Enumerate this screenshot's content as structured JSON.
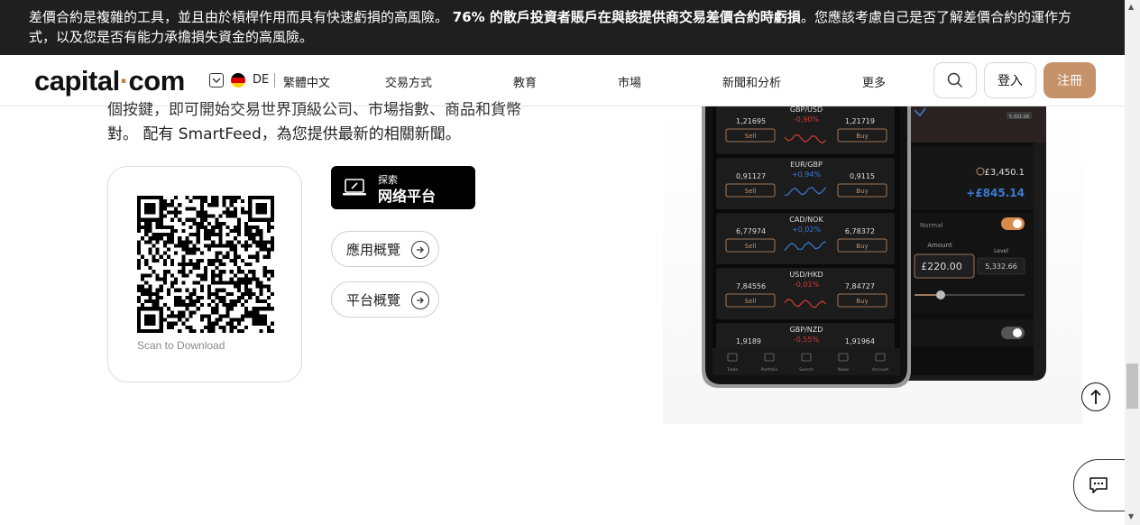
{
  "risk_banner": {
    "part1": "差價合約是複雜的工具，並且由於槓桿作用而具有快速虧損的高風險。",
    "bold": "76% 的散戶投資者賬戶在與該提供商交易差價合約時虧損",
    "part2": "。您應該考慮自己是否了解差價合約的運作方式，以及您是否有能力承擔損失資金的高風險。"
  },
  "header": {
    "logo_left": "capital",
    "logo_dot": "·",
    "logo_right": "com",
    "lang_code": "DE",
    "lang_name": "繁體中文",
    "nav": [
      "交易方式",
      "教育",
      "市場",
      "新聞和分析",
      "更多"
    ],
    "login": "登入",
    "signup": "注冊"
  },
  "main": {
    "desc_clipped": "個按鍵，即可開始交易世界頂級公司、市場指數、商品和貨幣",
    "desc_line2": "對。 配有 SmartFeed，為您提供最新的相關新聞。",
    "qr_caption": "Scan to Download",
    "web_btn_small": "探索",
    "web_btn_big": "网络平台",
    "app_overview": "應用概覽",
    "platform_overview": "平台概覽"
  },
  "phone": {
    "pairs": [
      {
        "name": "GBP/USD",
        "sell": "1,21695",
        "change": "-0,90%",
        "buy": "1,21719",
        "up": false
      },
      {
        "name": "EUR/GBP",
        "sell": "0,91127",
        "change": "+0,94%",
        "buy": "0,9115",
        "up": true
      },
      {
        "name": "CAD/NOK",
        "sell": "6,77974",
        "change": "+0,02%",
        "buy": "6,78372",
        "up": true
      },
      {
        "name": "USD/HKD",
        "sell": "7,84556",
        "change": "-0,01%",
        "buy": "7,84727",
        "up": false
      },
      {
        "name": "GBP/NZD",
        "sell": "1,9189",
        "change": "-0,55%",
        "buy": "1,91964",
        "up": false
      }
    ],
    "sell_label": "Sell",
    "buy_label": "Buy",
    "tabs": [
      "Trade",
      "Portfolio",
      "Search",
      "News",
      "Account"
    ],
    "back_value": "£3,450.1",
    "back_pnl": "+£845.14",
    "back_mode": "Normal",
    "back_amount_label": "Amount",
    "back_amount": "£220.00",
    "back_level_label": "Level",
    "back_level": "5,332.66",
    "back_price": "5,331.06"
  },
  "colors": {
    "accent": "#c6926a",
    "banner_bg": "#1f1f1f",
    "positive": "#3a7bd5",
    "negative": "#d23a3a"
  }
}
